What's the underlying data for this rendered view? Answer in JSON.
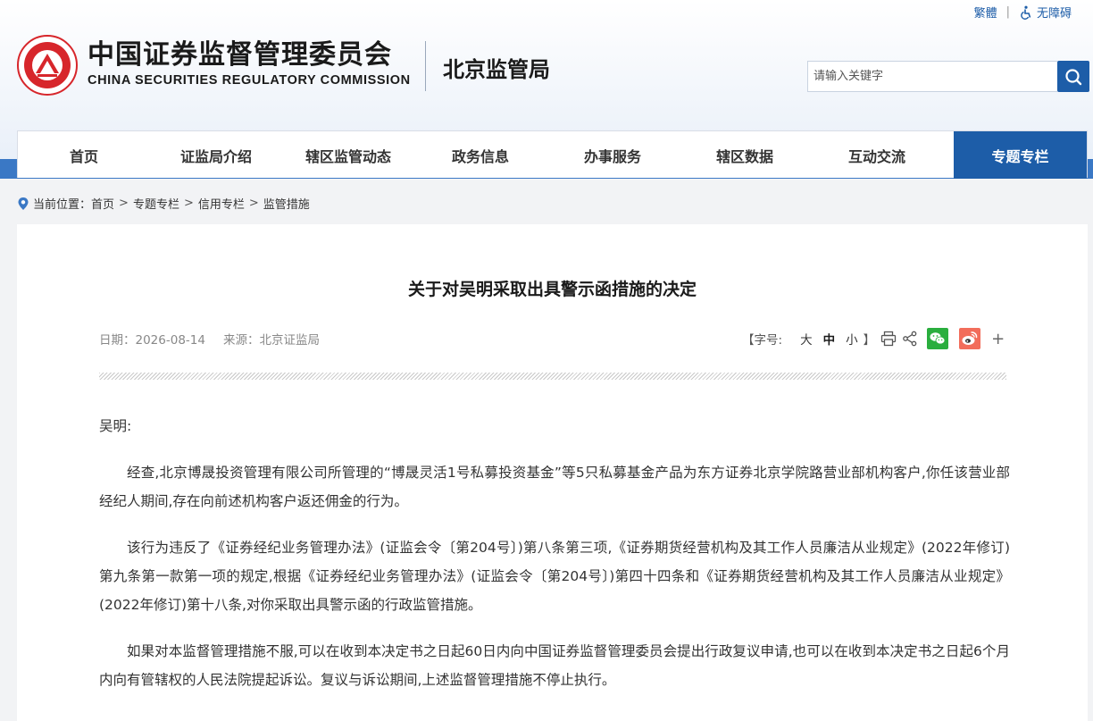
{
  "top_links": {
    "traditional": "繁體",
    "separator": "|",
    "accessibility": "无障碍"
  },
  "logo": {
    "cn_name": "中国证券监督管理委员会",
    "en_name": "CHINA SECURITIES REGULATORY COMMISSION",
    "seal_text": "中国证券监督管理委员会 CHINA SECURITIES REGULATORY COMMISSION"
  },
  "bureau": "北京监管局",
  "search": {
    "placeholder": "请输入关键字"
  },
  "nav": [
    {
      "label": "首页"
    },
    {
      "label": "证监局介绍"
    },
    {
      "label": "辖区监管动态"
    },
    {
      "label": "政务信息"
    },
    {
      "label": "办事服务"
    },
    {
      "label": "辖区数据"
    },
    {
      "label": "互动交流"
    },
    {
      "label": "专题专栏",
      "active": true
    }
  ],
  "breadcrumb": {
    "prefix": "当前位置：",
    "items": [
      "首页",
      "专题专栏",
      "信用专栏",
      "监管措施"
    ],
    "separator": ">"
  },
  "article": {
    "title": "关于对吴明采取出具警示函措施的决定",
    "date_label": "日期：",
    "date": "2026-08-14",
    "source_label": "来源：",
    "source": "北京证监局",
    "font_size_label": "【字号:",
    "font_sizes": [
      "大",
      "中",
      "小"
    ],
    "font_size_close": "】",
    "plus": "+",
    "salutation": "吴明:",
    "paragraphs": [
      "经查,北京博晟投资管理有限公司所管理的“博晟灵活1号私募投资基金”等5只私募基金产品为东方证券北京学院路营业部机构客户,你任该营业部经纪人期间,存在向前述机构客户返还佣金的行为。",
      "该行为违反了《证券经纪业务管理办法》(证监会令〔第204号〕)第八条第三项,《证券期货经营机构及其工作人员廉洁从业规定》(2022年修订)第九条第一款第一项的规定,根据《证券经纪业务管理办法》(证监会令〔第204号〕)第四十四条和《证券期货经营机构及其工作人员廉洁从业规定》(2022年修订)第十八条,对你采取出具警示函的行政监管措施。",
      "如果对本监督管理措施不服,可以在收到本决定书之日起60日内向中国证券监督管理委员会提出行政复议申请,也可以在收到本决定书之日起6个月内向有管辖权的人民法院提起诉讼。复议与诉讼期间,上述监督管理措施不停止执行。"
    ]
  },
  "colors": {
    "brand_blue": "#1d5da8",
    "band_blue": "#3a78c5",
    "logo_red": "#d7262b",
    "wechat_green": "#2aae3e",
    "weibo_orange": "#f26d5b"
  },
  "icons": [
    "accessibility-icon",
    "search-icon",
    "location-pin-icon",
    "print-icon",
    "share-icon",
    "wechat-icon",
    "weibo-icon"
  ]
}
